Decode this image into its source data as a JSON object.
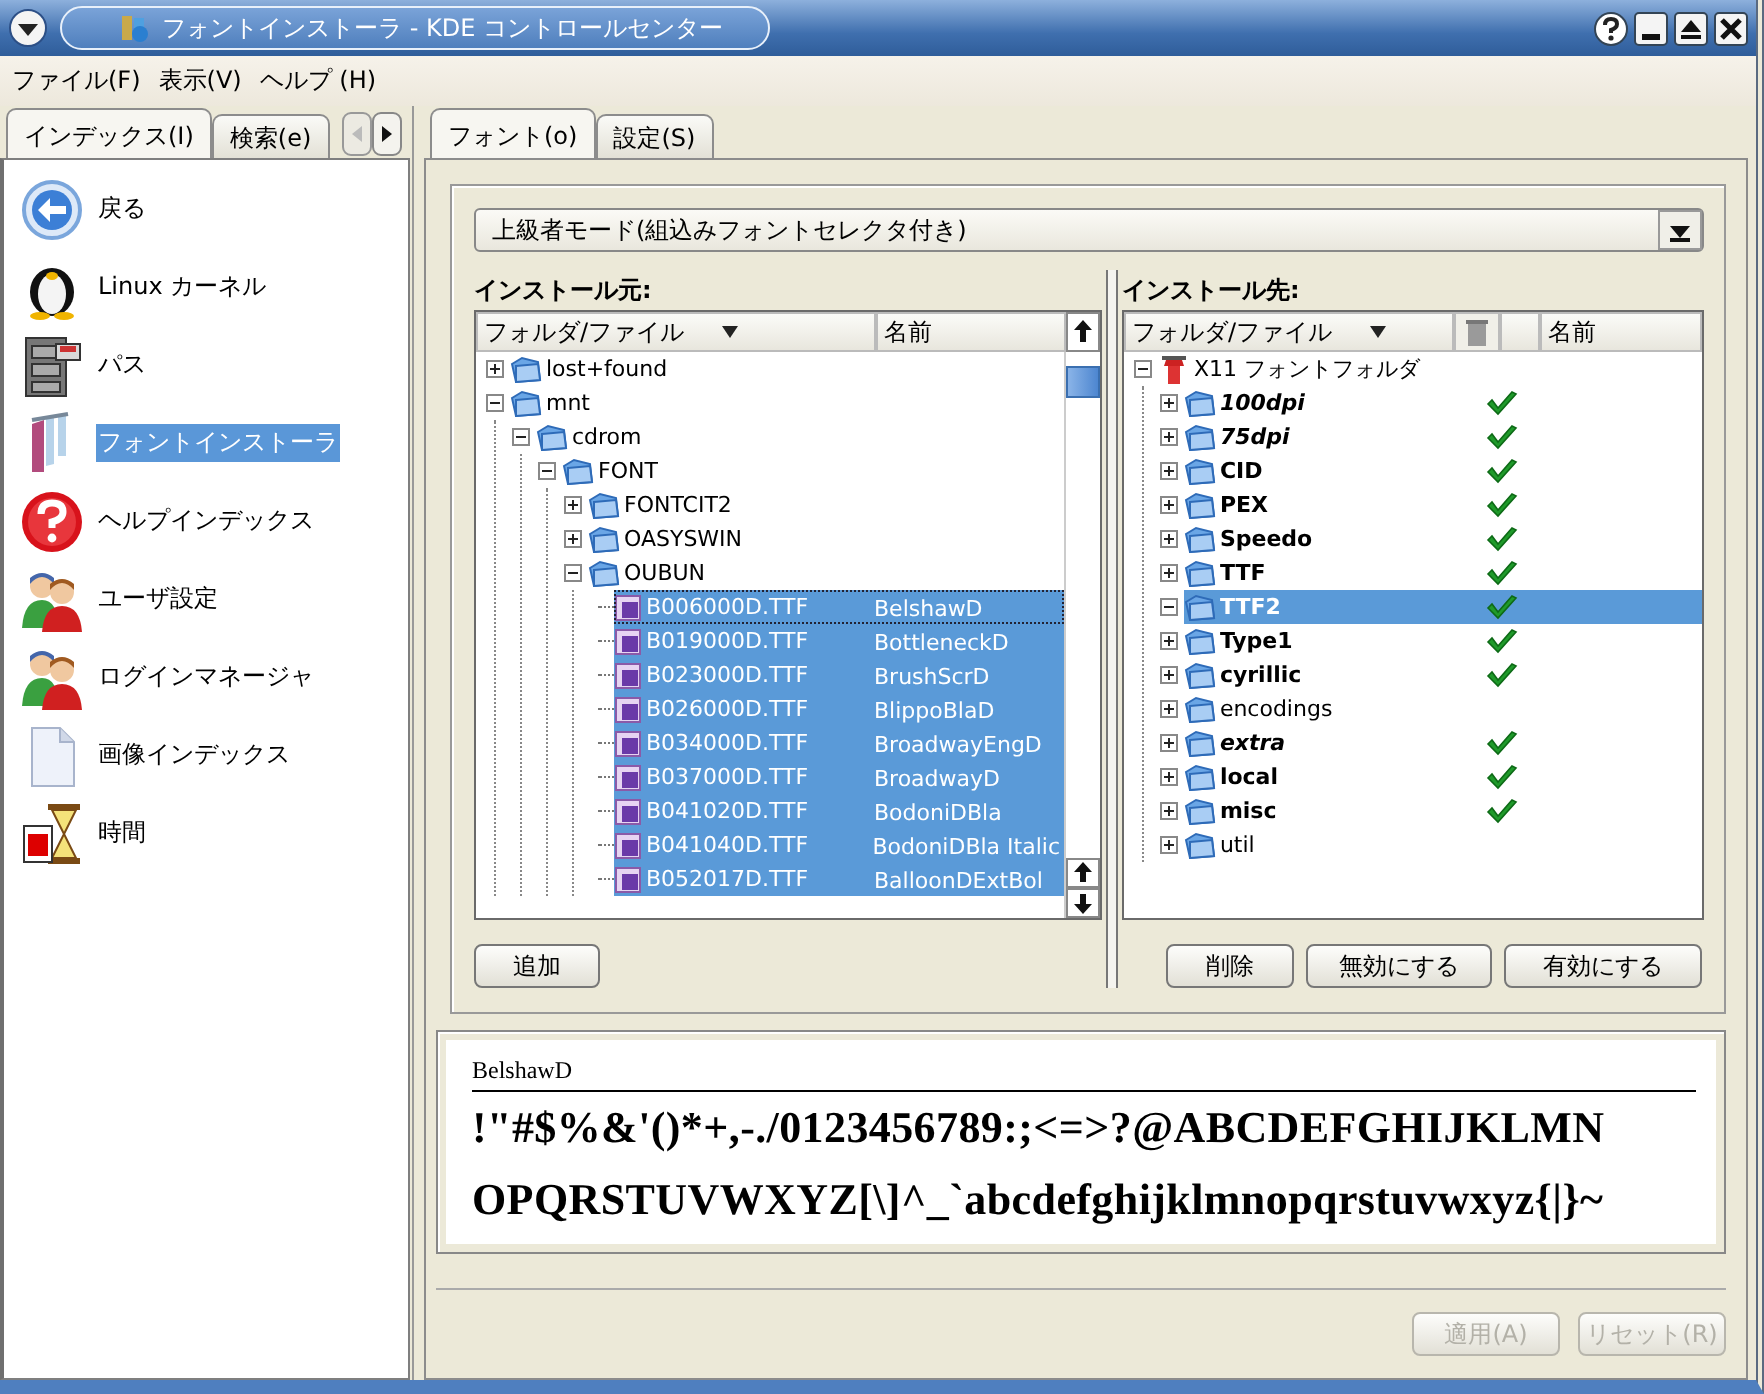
{
  "window": {
    "title": "フォントインストーラ - KDE コントロールセンター"
  },
  "menu": [
    "ファイル(F)",
    "表示(V)",
    "ヘルプ (H)"
  ],
  "sidebar": {
    "tabs": [
      {
        "label": "インデックス(I)",
        "selected": true
      },
      {
        "label": "検索(e)",
        "selected": false
      }
    ],
    "items": [
      {
        "label": "戻る",
        "selected": false
      },
      {
        "label": "Linux カーネル",
        "selected": false
      },
      {
        "label": "パス",
        "selected": false
      },
      {
        "label": "フォントインストーラ",
        "selected": true
      },
      {
        "label": "ヘルプインデックス",
        "selected": false
      },
      {
        "label": "ユーザ設定",
        "selected": false
      },
      {
        "label": "ログインマネージャ",
        "selected": false
      },
      {
        "label": "画像インデックス",
        "selected": false
      },
      {
        "label": "時間",
        "selected": false
      }
    ]
  },
  "tabs": [
    {
      "label": "フォント(o)",
      "selected": true
    },
    {
      "label": "設定(S)",
      "selected": false
    }
  ],
  "mode_select": {
    "value": "上級者モード(組込みフォントセレクタ付き)"
  },
  "source": {
    "label": "インストール元:",
    "columns": [
      "フォルダ/ファイル",
      "名前"
    ],
    "tree": [
      {
        "kind": "folder",
        "label": "lost+found",
        "expanded": false,
        "selected": false
      },
      {
        "kind": "folder",
        "label": "mnt",
        "expanded": true,
        "selected": false,
        "children": [
          {
            "kind": "folder",
            "label": "cdrom",
            "expanded": true,
            "selected": false,
            "children": [
              {
                "kind": "folder",
                "label": "FONT",
                "expanded": true,
                "selected": false,
                "children": [
                  {
                    "kind": "folder",
                    "label": "FONTCIT2",
                    "expanded": false,
                    "selected": false
                  },
                  {
                    "kind": "folder",
                    "label": "OASYSWIN",
                    "expanded": false,
                    "selected": false
                  },
                  {
                    "kind": "folder",
                    "label": "OUBUN",
                    "expanded": true,
                    "selected": false,
                    "children": [
                      {
                        "kind": "file",
                        "label": "B006000D.TTF",
                        "name": "BelshawD",
                        "selected": true,
                        "focused": true
                      },
                      {
                        "kind": "file",
                        "label": "B019000D.TTF",
                        "name": "BottleneckD",
                        "selected": true,
                        "focused": false
                      },
                      {
                        "kind": "file",
                        "label": "B023000D.TTF",
                        "name": "BrushScrD",
                        "selected": true,
                        "focused": false
                      },
                      {
                        "kind": "file",
                        "label": "B026000D.TTF",
                        "name": "BlippoBlaD",
                        "selected": true,
                        "focused": false
                      },
                      {
                        "kind": "file",
                        "label": "B034000D.TTF",
                        "name": "BroadwayEngD",
                        "selected": true,
                        "focused": false
                      },
                      {
                        "kind": "file",
                        "label": "B037000D.TTF",
                        "name": "BroadwayD",
                        "selected": true,
                        "focused": false
                      },
                      {
                        "kind": "file",
                        "label": "B041020D.TTF",
                        "name": "BodoniDBla",
                        "selected": true,
                        "focused": false
                      },
                      {
                        "kind": "file",
                        "label": "B041040D.TTF",
                        "name": "BodoniDBla Italic",
                        "selected": true,
                        "focused": false
                      },
                      {
                        "kind": "file",
                        "label": "B052017D.TTF",
                        "name": "BalloonDExtBol",
                        "selected": true,
                        "focused": false
                      }
                    ]
                  }
                ]
              }
            ]
          }
        ]
      }
    ],
    "buttons": [
      "追加"
    ]
  },
  "destination": {
    "label": "インストール先:",
    "columns": [
      "フォルダ/ファイル",
      "名前"
    ],
    "tree": [
      {
        "kind": "root",
        "label": "X11 フォントフォルダ",
        "expanded": true,
        "selected": false,
        "children": [
          {
            "kind": "folder",
            "label": "100dpi",
            "expanded": false,
            "enabled": true,
            "italic": true,
            "selected": false
          },
          {
            "kind": "folder",
            "label": "75dpi",
            "expanded": false,
            "enabled": true,
            "italic": true,
            "selected": false
          },
          {
            "kind": "folder",
            "label": "CID",
            "expanded": false,
            "enabled": true,
            "italic": false,
            "selected": false
          },
          {
            "kind": "folder",
            "label": "PEX",
            "expanded": false,
            "enabled": true,
            "italic": false,
            "selected": false
          },
          {
            "kind": "folder",
            "label": "Speedo",
            "expanded": false,
            "enabled": true,
            "italic": false,
            "selected": false
          },
          {
            "kind": "folder",
            "label": "TTF",
            "expanded": false,
            "enabled": true,
            "italic": false,
            "selected": false
          },
          {
            "kind": "folder",
            "label": "TTF2",
            "expanded": true,
            "enabled": true,
            "italic": false,
            "selected": true
          },
          {
            "kind": "folder",
            "label": "Type1",
            "expanded": false,
            "enabled": true,
            "italic": false,
            "selected": false
          },
          {
            "kind": "folder",
            "label": "cyrillic",
            "expanded": false,
            "enabled": true,
            "italic": false,
            "selected": false
          },
          {
            "kind": "folder",
            "label": "encodings",
            "expanded": false,
            "enabled": false,
            "italic": false,
            "selected": false
          },
          {
            "kind": "folder",
            "label": "extra",
            "expanded": false,
            "enabled": true,
            "italic": true,
            "selected": false
          },
          {
            "kind": "folder",
            "label": "local",
            "expanded": false,
            "enabled": true,
            "italic": false,
            "selected": false
          },
          {
            "kind": "folder",
            "label": "misc",
            "expanded": false,
            "enabled": true,
            "italic": false,
            "selected": false
          },
          {
            "kind": "folder",
            "label": "util",
            "expanded": false,
            "enabled": false,
            "italic": false,
            "selected": false
          }
        ]
      }
    ],
    "buttons": [
      "削除",
      "無効にする",
      "有効にする"
    ]
  },
  "preview": {
    "font_name": "BelshawD",
    "lines": [
      "!\"#$%&'()*+,-./0123456789:;<=>?@ABCDEFGHIJKLMN",
      "OPQRSTUVWXYZ[\\]^_`abcdefghijklmnopqrstuvwxyz{|}~"
    ]
  },
  "footer_buttons": [
    {
      "label": "適用(A)",
      "disabled": true
    },
    {
      "label": "リセット(R)",
      "disabled": true
    }
  ]
}
